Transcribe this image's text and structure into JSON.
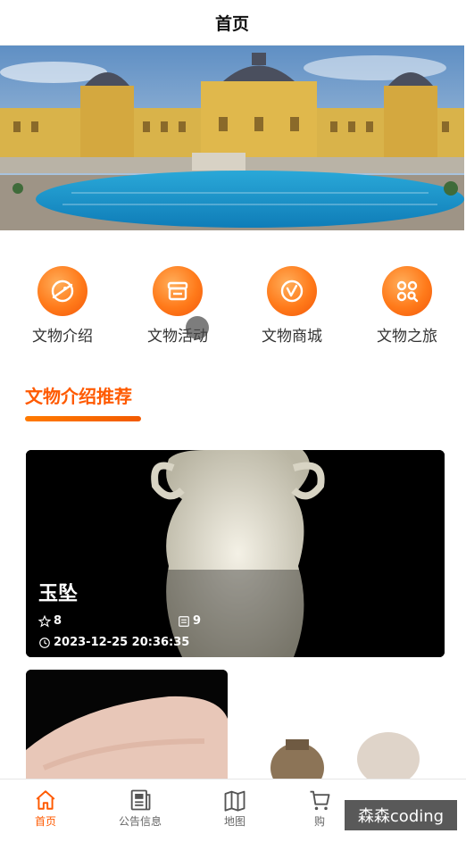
{
  "header": {
    "title": "首页"
  },
  "banner": {
    "dots_count": 3,
    "active_dot": 2
  },
  "quick_nav": [
    {
      "label": "文物介绍",
      "icon": "planet-icon"
    },
    {
      "label": "文物活动",
      "icon": "shop-icon"
    },
    {
      "label": "文物商城",
      "icon": "v-badge-icon"
    },
    {
      "label": "文物之旅",
      "icon": "apps-search-icon"
    }
  ],
  "section": {
    "title": "文物介绍推荐"
  },
  "featured": {
    "title": "玉坠",
    "stars": "8",
    "views": "9",
    "datetime": "2023-12-25 20:36:35"
  },
  "tabbar": [
    {
      "label": "首页",
      "icon": "home-icon",
      "active": true
    },
    {
      "label": "公告信息",
      "icon": "news-icon",
      "active": false
    },
    {
      "label": "地图",
      "icon": "map-icon",
      "active": false
    },
    {
      "label": "购",
      "icon": "cart-icon",
      "active": false
    }
  ],
  "watermark": "森森coding",
  "colors": {
    "accent": "#ff5a00",
    "icon_orange": "#ff7a1a"
  }
}
